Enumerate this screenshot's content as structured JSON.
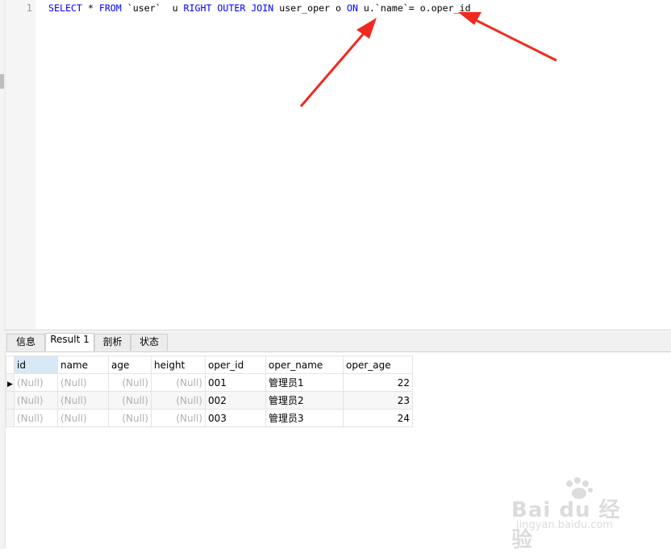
{
  "editor": {
    "line_number": "1",
    "sql": {
      "t1": "SELECT",
      "t2": " * ",
      "t3": "FROM",
      "t4": " `user`  u ",
      "t5": "RIGHT OUTER JOIN",
      "t6": " user_oper o ",
      "t7": "ON",
      "t8": " u.`name`= o.oper_id"
    }
  },
  "tabs": [
    {
      "label": "信息"
    },
    {
      "label": "Result 1"
    },
    {
      "label": "剖析"
    },
    {
      "label": "状态"
    }
  ],
  "grid": {
    "columns": [
      "id",
      "name",
      "age",
      "height",
      "oper_id",
      "oper_name",
      "oper_age"
    ],
    "rows": [
      [
        "(Null)",
        "(Null)",
        "(Null)",
        "(Null)",
        "001",
        "管理员1",
        "22"
      ],
      [
        "(Null)",
        "(Null)",
        "(Null)",
        "(Null)",
        "002",
        "管理员2",
        "23"
      ],
      [
        "(Null)",
        "(Null)",
        "(Null)",
        "(Null)",
        "003",
        "管理员3",
        "24"
      ]
    ],
    "current_row_marker": "▶"
  },
  "watermark": {
    "main": "Bai du 经验",
    "sub": "jingyan.baidu.com"
  },
  "colors": {
    "keyword": "#0000ff",
    "arrow": "#f02a1e",
    "null_text": "#b0b0b0",
    "selected_header": "#d9e8f7"
  },
  "icons": {
    "arrow": "red-annotation-arrow",
    "row_marker": "current-row-triangle"
  }
}
